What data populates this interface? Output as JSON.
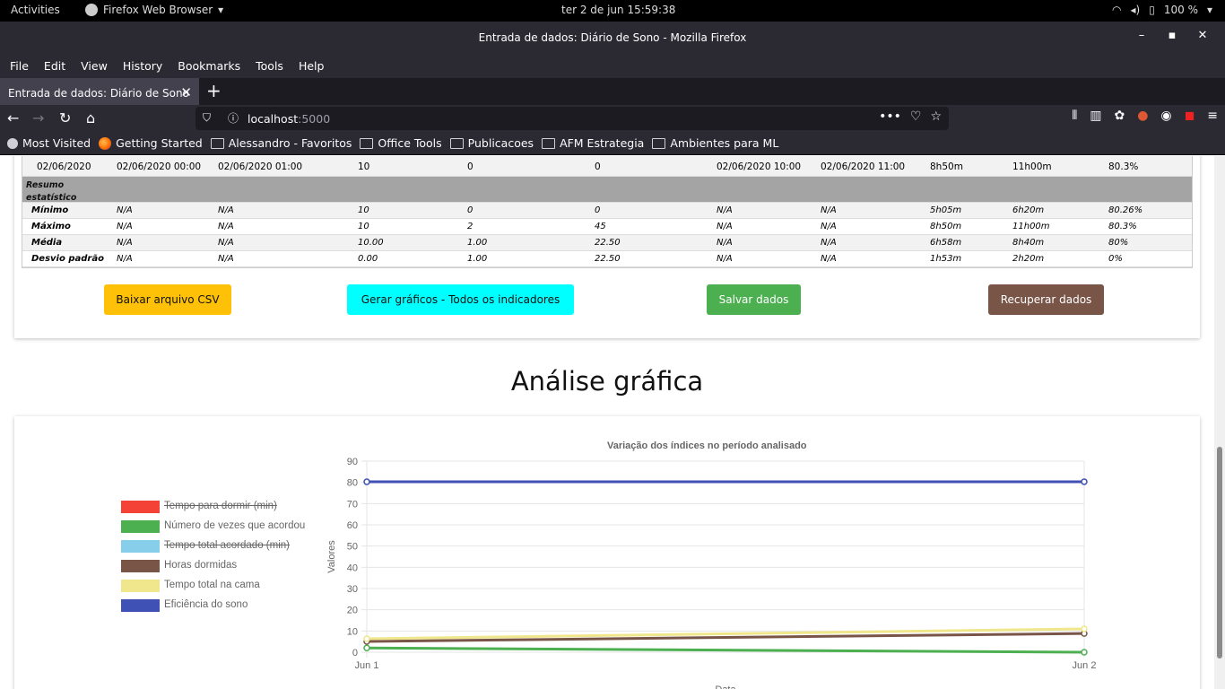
{
  "system": {
    "activities": "Activities",
    "app_name": "Firefox Web Browser",
    "clock": "ter 2 de jun  15:59:38",
    "battery": "100 %"
  },
  "window": {
    "title": "Entrada de dados: Diário de Sono - Mozilla Firefox"
  },
  "menu": [
    "File",
    "Edit",
    "View",
    "History",
    "Bookmarks",
    "Tools",
    "Help"
  ],
  "tab": {
    "label": "Entrada de dados: Diário de Sono"
  },
  "urlbar": {
    "host": "localhost",
    "port": ":5000"
  },
  "bookmarks": [
    {
      "label": "Most Visited",
      "icon": "gear-icon"
    },
    {
      "label": "Getting Started",
      "icon": "firefox-icon"
    },
    {
      "label": "Alessandro - Favoritos",
      "icon": "folder-icon"
    },
    {
      "label": "Office Tools",
      "icon": "folder-icon"
    },
    {
      "label": "Publicacoes",
      "icon": "folder-icon"
    },
    {
      "label": "AFM Estrategia",
      "icon": "folder-icon"
    },
    {
      "label": "Ambientes para ML",
      "icon": "folder-icon"
    }
  ],
  "table": {
    "data_row": [
      "02/06/2020",
      "02/06/2020 00:00",
      "02/06/2020 01:00",
      "10",
      "0",
      "0",
      "02/06/2020 10:00",
      "02/06/2020 11:00",
      "8h50m",
      "11h00m",
      "80.3%"
    ],
    "summary_label": "Resumo estatístico",
    "stats": [
      {
        "label": "Mínimo",
        "values": [
          "N/A",
          "N/A",
          "10",
          "0",
          "0",
          "N/A",
          "N/A",
          "5h05m",
          "6h20m",
          "80.26%"
        ]
      },
      {
        "label": "Máximo",
        "values": [
          "N/A",
          "N/A",
          "10",
          "2",
          "45",
          "N/A",
          "N/A",
          "8h50m",
          "11h00m",
          "80.3%"
        ]
      },
      {
        "label": "Média",
        "values": [
          "N/A",
          "N/A",
          "10.00",
          "1.00",
          "22.50",
          "N/A",
          "N/A",
          "6h58m",
          "8h40m",
          "80%"
        ]
      },
      {
        "label": "Desvio padrão",
        "values": [
          "N/A",
          "N/A",
          "0.00",
          "1.00",
          "22.50",
          "N/A",
          "N/A",
          "1h53m",
          "2h20m",
          "0%"
        ]
      }
    ]
  },
  "buttons": {
    "csv": "Baixar arquivo CSV",
    "graphs": "Gerar gráficos - Todos os indicadores",
    "save": "Salvar dados",
    "recover": "Recuperar dados"
  },
  "colors": {
    "csv": "#ffc107",
    "graphs": "#00ffff",
    "save": "#4caf50",
    "recover": "#795548"
  },
  "section_title": "Análise gráfica",
  "chart_data": {
    "type": "line",
    "title": "Variação dos índices no período analisado",
    "xlabel": "Data",
    "ylabel": "Valores",
    "categories": [
      "Jun 1",
      "Jun 2"
    ],
    "ylim": [
      0,
      90
    ],
    "yticks": [
      0,
      10,
      20,
      30,
      40,
      50,
      60,
      70,
      80,
      90
    ],
    "legend_position": "left",
    "series": [
      {
        "name": "Tempo para dormir (min)",
        "color": "#f44336",
        "hidden": true,
        "values": [
          null,
          null
        ]
      },
      {
        "name": "Número de vezes que acordou",
        "color": "#4caf50",
        "hidden": false,
        "values": [
          2,
          0
        ]
      },
      {
        "name": "Tempo total acordado (min)",
        "color": "#87ceeb",
        "hidden": true,
        "values": [
          null,
          null
        ]
      },
      {
        "name": "Horas dormidas",
        "color": "#795548",
        "hidden": false,
        "values": [
          5.08,
          8.83
        ]
      },
      {
        "name": "Tempo total na cama",
        "color": "#f0e68c",
        "hidden": false,
        "values": [
          6.33,
          11
        ]
      },
      {
        "name": "Eficiência do sono",
        "color": "#3f51b5",
        "hidden": false,
        "values": [
          80.26,
          80.3
        ]
      }
    ]
  }
}
